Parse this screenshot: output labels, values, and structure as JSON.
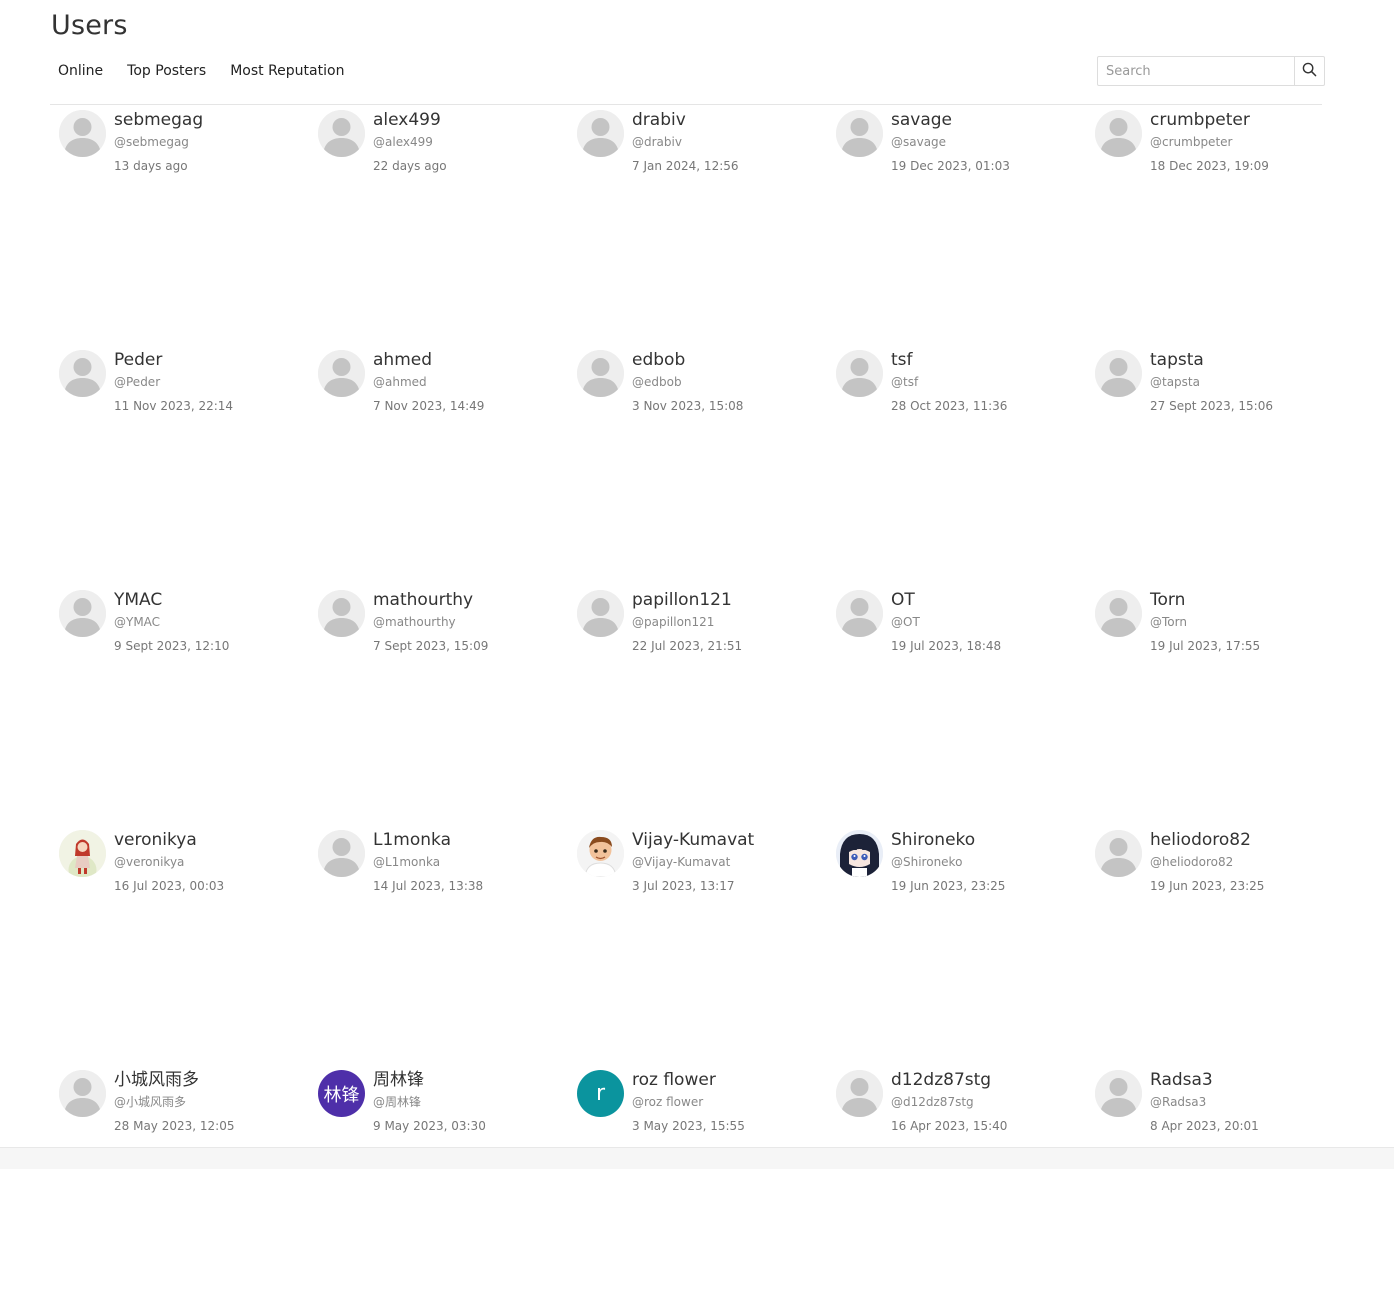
{
  "page": {
    "title": "Users"
  },
  "tabs": [
    "Online",
    "Top Posters",
    "Most Reputation"
  ],
  "search": {
    "placeholder": "Search",
    "icon": "search-icon"
  },
  "colors": {
    "default_avatar_bg": "#eeeeee",
    "default_avatar_fg": "#c4c4c4",
    "avatar_purple": "#4e2fa9",
    "avatar_teal": "#0b949e"
  },
  "users": [
    {
      "name": "sebmegag",
      "handle": "@sebmegag",
      "time": "13 days ago",
      "avatar": "default"
    },
    {
      "name": "alex499",
      "handle": "@alex499",
      "time": "22 days ago",
      "avatar": "default"
    },
    {
      "name": "drabiv",
      "handle": "@drabiv",
      "time": "7 Jan 2024, 12:56",
      "avatar": "default"
    },
    {
      "name": "savage",
      "handle": "@savage",
      "time": "19 Dec 2023, 01:03",
      "avatar": "default"
    },
    {
      "name": "crumbpeter",
      "handle": "@crumbpeter",
      "time": "18 Dec 2023, 19:09",
      "avatar": "default"
    },
    {
      "name": "Peder",
      "handle": "@Peder",
      "time": "11 Nov 2023, 22:14",
      "avatar": "default"
    },
    {
      "name": "ahmed",
      "handle": "@ahmed",
      "time": "7 Nov 2023, 14:49",
      "avatar": "default"
    },
    {
      "name": "edbob",
      "handle": "@edbob",
      "time": "3 Nov 2023, 15:08",
      "avatar": "default"
    },
    {
      "name": "tsf",
      "handle": "@tsf",
      "time": "28 Oct 2023, 11:36",
      "avatar": "default"
    },
    {
      "name": "tapsta",
      "handle": "@tapsta",
      "time": "27 Sept 2023, 15:06",
      "avatar": "default"
    },
    {
      "name": "YMAC",
      "handle": "@YMAC",
      "time": "9 Sept 2023, 12:10",
      "avatar": "default"
    },
    {
      "name": "mathourthy",
      "handle": "@mathourthy",
      "time": "7 Sept 2023, 15:09",
      "avatar": "default"
    },
    {
      "name": "papillon121",
      "handle": "@papillon121",
      "time": "22 Jul 2023, 21:51",
      "avatar": "default"
    },
    {
      "name": "OT",
      "handle": "@OT",
      "time": "19 Jul 2023, 18:48",
      "avatar": "default"
    },
    {
      "name": "Torn",
      "handle": "@Torn",
      "time": "19 Jul 2023, 17:55",
      "avatar": "default"
    },
    {
      "name": "veronikya",
      "handle": "@veronikya",
      "time": "16 Jul 2023, 00:03",
      "avatar": "photo-girl"
    },
    {
      "name": "L1monka",
      "handle": "@L1monka",
      "time": "14 Jul 2023, 13:38",
      "avatar": "default"
    },
    {
      "name": "Vijay-Kumavat",
      "handle": "@Vijay-Kumavat",
      "time": "3 Jul 2023, 13:17",
      "avatar": "photo-cartoon-boy"
    },
    {
      "name": "Shironeko",
      "handle": "@Shironeko",
      "time": "19 Jun 2023, 23:25",
      "avatar": "photo-anime"
    },
    {
      "name": "heliodoro82",
      "handle": "@heliodoro82",
      "time": "19 Jun 2023, 23:25",
      "avatar": "default"
    },
    {
      "name": "小城风雨多",
      "handle": "@小城风雨多",
      "time": "28 May 2023, 12:05",
      "avatar": "default"
    },
    {
      "name": "周林锋",
      "handle": "@周林锋",
      "time": "9 May 2023, 03:30",
      "avatar": "text",
      "avatar_text": "林锋",
      "avatar_color": "#4e2fa9"
    },
    {
      "name": "roz flower",
      "handle": "@roz flower",
      "time": "3 May 2023, 15:55",
      "avatar": "text",
      "avatar_text": "r",
      "avatar_color": "#0b949e"
    },
    {
      "name": "d12dz87stg",
      "handle": "@d12dz87stg",
      "time": "16 Apr 2023, 15:40",
      "avatar": "default"
    },
    {
      "name": "Radsa3",
      "handle": "@Radsa3",
      "time": "8 Apr 2023, 20:01",
      "avatar": "default"
    }
  ]
}
